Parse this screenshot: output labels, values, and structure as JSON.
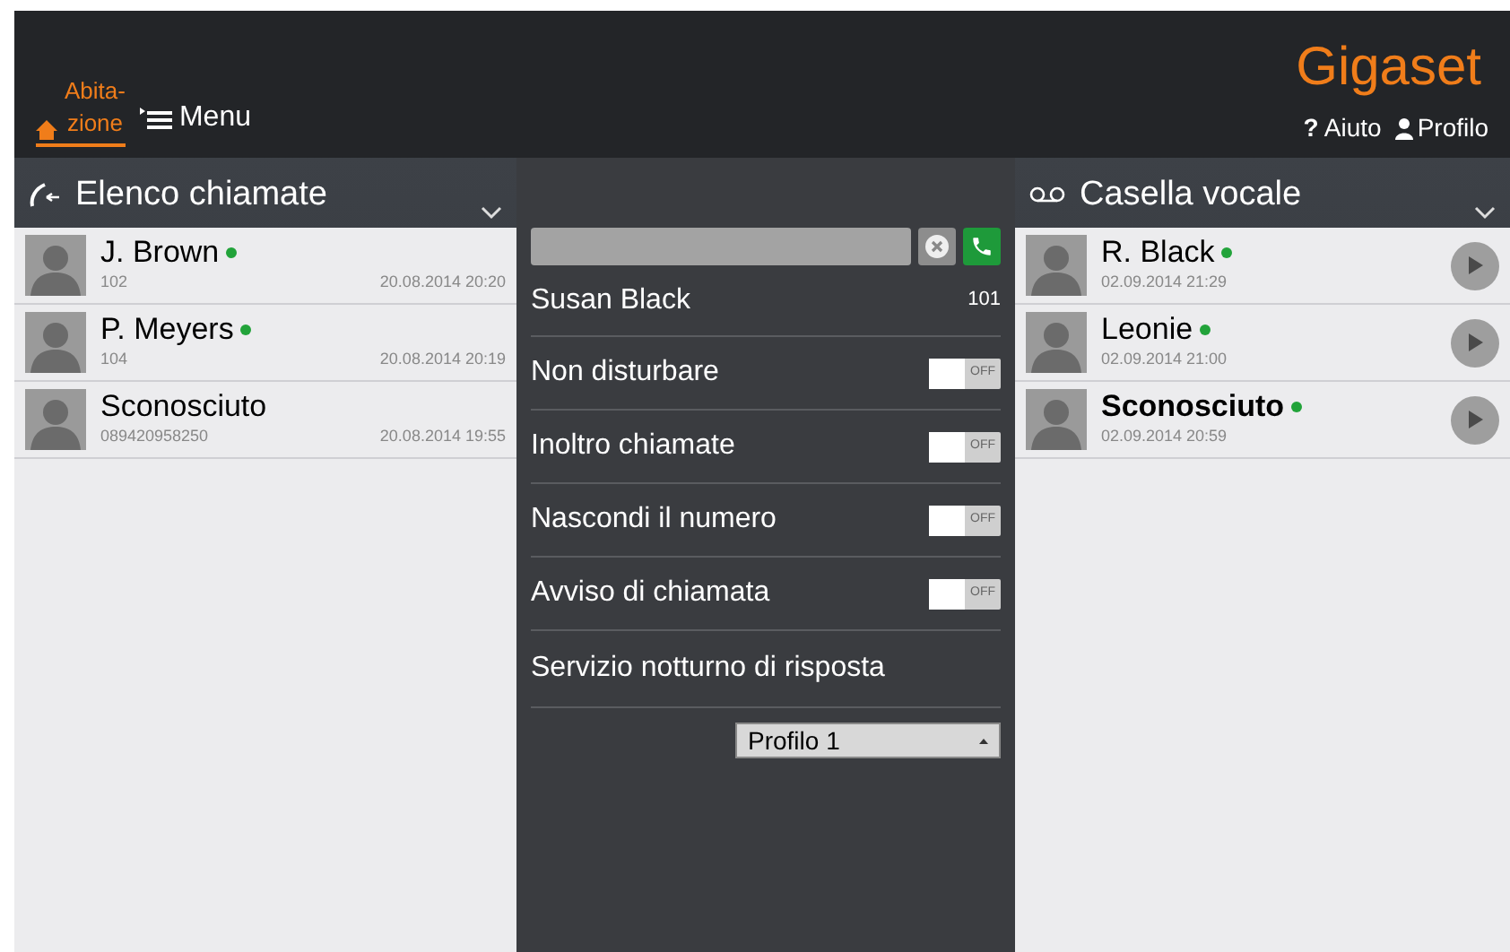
{
  "header": {
    "logo": "Gigaset",
    "home_tab": {
      "label": "Abita-\nzione",
      "selected": true
    },
    "menu": "Menu",
    "help_mark": "?",
    "help": "Aiuto",
    "profile": "Profilo"
  },
  "calls": {
    "title": "Elenco chiamate",
    "items": [
      {
        "name": "J. Brown",
        "online": true,
        "number": "102",
        "time": "20.08.2014 20:20"
      },
      {
        "name": "P. Meyers",
        "online": true,
        "number": "104",
        "time": "20.08.2014 20:19"
      },
      {
        "name": "Sconosciuto",
        "online": false,
        "number": "089420958250",
        "time": "20.08.2014 19:55"
      }
    ]
  },
  "settings": {
    "user": "Susan Black",
    "extension": "101",
    "toggles": [
      {
        "label": "Non disturbare",
        "on": false,
        "state_text": "OFF"
      },
      {
        "label": "Inoltro chiamate",
        "on": false,
        "state_text": "OFF"
      },
      {
        "label": "Nascondi il numero",
        "on": false,
        "state_text": "OFF"
      },
      {
        "label": "Avviso di chiamata",
        "on": false,
        "state_text": "OFF"
      }
    ],
    "night_service": "Servizio notturno di risposta",
    "profile_select": "Profilo 1"
  },
  "voicemail": {
    "title": "Casella vocale",
    "items": [
      {
        "name": "R. Black",
        "online": true,
        "emphasized": false,
        "time": "02.09.2014 21:29"
      },
      {
        "name": "Leonie",
        "online": true,
        "emphasized": false,
        "time": "02.09.2014 21:00"
      },
      {
        "name": "Sconosciuto",
        "online": true,
        "emphasized": true,
        "time": "02.09.2014 20:59"
      }
    ]
  }
}
